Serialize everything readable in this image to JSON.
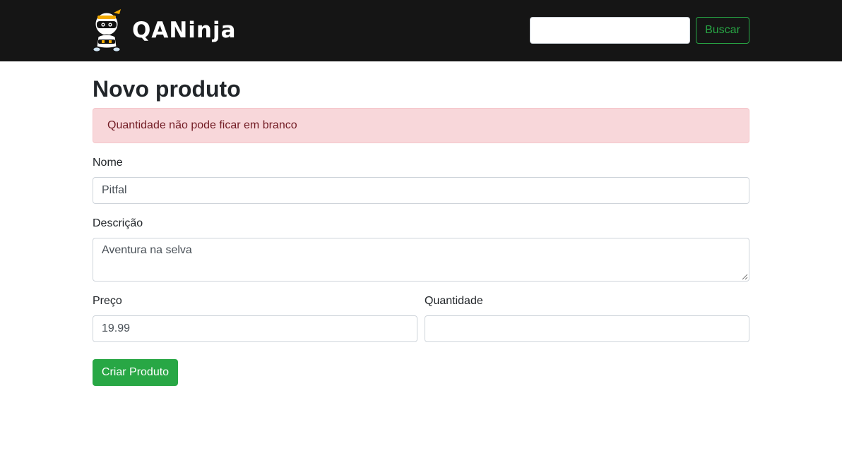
{
  "header": {
    "brand": {
      "logo_icon": "ninja-mascot-icon",
      "name": "QANinja"
    },
    "search": {
      "value": "",
      "placeholder": ""
    },
    "search_button_label": "Buscar",
    "background_color": "#151515"
  },
  "main": {
    "title": "Novo produto",
    "alert": {
      "message": "Quantidade não pode ficar em branco",
      "background_color": "#f8d7da",
      "text_color": "#721c24"
    },
    "form": {
      "name": {
        "label": "Nome",
        "value": "Pitfal"
      },
      "description": {
        "label": "Descrição",
        "value": "Aventura na selva"
      },
      "price": {
        "label": "Preço",
        "value": "19.99"
      },
      "quantity": {
        "label": "Quantidade",
        "value": ""
      },
      "submit_label": "Criar Produto"
    },
    "accent_color": "#28a745"
  }
}
